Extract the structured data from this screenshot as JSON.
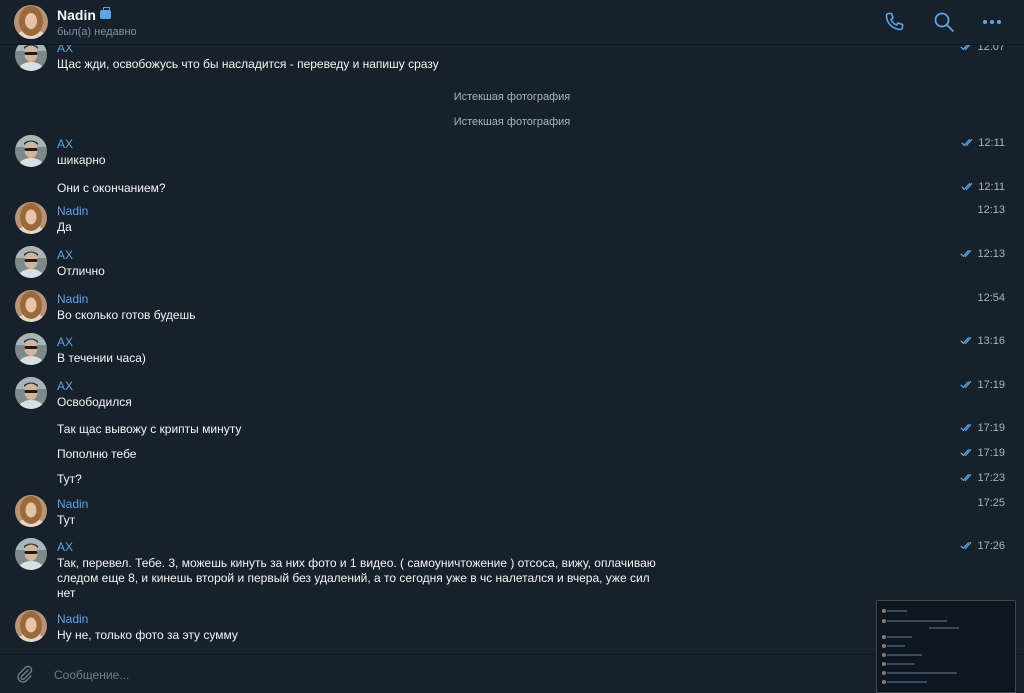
{
  "header": {
    "contact_name": "Nadin",
    "status": "был(а) недавно",
    "icons": [
      "phone-icon",
      "search-icon",
      "more-icon",
      "briefcase-icon"
    ]
  },
  "messages": [
    {
      "sender": "AX",
      "text": "Щас жди,  освобожусь что бы насладится - переведу и напишу сразу",
      "time": "12:07"
    },
    {
      "service": "Истекшая фотография"
    },
    {
      "service": "Истекшая фотография"
    },
    {
      "sender": "AX",
      "text": "шикарно",
      "time": "12:11"
    },
    {
      "text": "Они с окончанием?",
      "time": "12:11"
    },
    {
      "sender": "Nadin",
      "text": "Да",
      "time": "12:13"
    },
    {
      "sender": "AX",
      "text": "Отлично",
      "time": "12:13"
    },
    {
      "sender": "Nadin",
      "text": "Во сколько готов будешь",
      "time": "12:54"
    },
    {
      "sender": "AX",
      "text": "В течении часа)",
      "time": "13:16"
    },
    {
      "sender": "AX",
      "text": "Освободился",
      "time": "17:19"
    },
    {
      "text": "Так щас вывожу с крипты минуту",
      "time": "17:19"
    },
    {
      "text": "Пополню тебе",
      "time": "17:19"
    },
    {
      "text": "Тут?",
      "time": "17:23"
    },
    {
      "sender": "Nadin",
      "text": "Тут",
      "time": "17:25"
    },
    {
      "sender": "AX",
      "text": "Так, перевел. Тебе. 3, можешь кинуть за них фото и 1 видео. ( самоуничтожение ) отсоса,  вижу,  оплачиваю следом еще 8,  и кинешь второй и первый без удалений,  а то сегодня уже в чс налетался и вчера,  уже сил нет",
      "time": "17:26"
    },
    {
      "sender": "Nadin",
      "text": "Ну не, только фото за эту сумму",
      "time": ""
    }
  ],
  "input": {
    "placeholder": "Сообщение..."
  },
  "colors": {
    "background": "#17212b",
    "accent": "#5ea5e6",
    "text": "#f5f5f5",
    "muted": "#a7b4c2"
  }
}
